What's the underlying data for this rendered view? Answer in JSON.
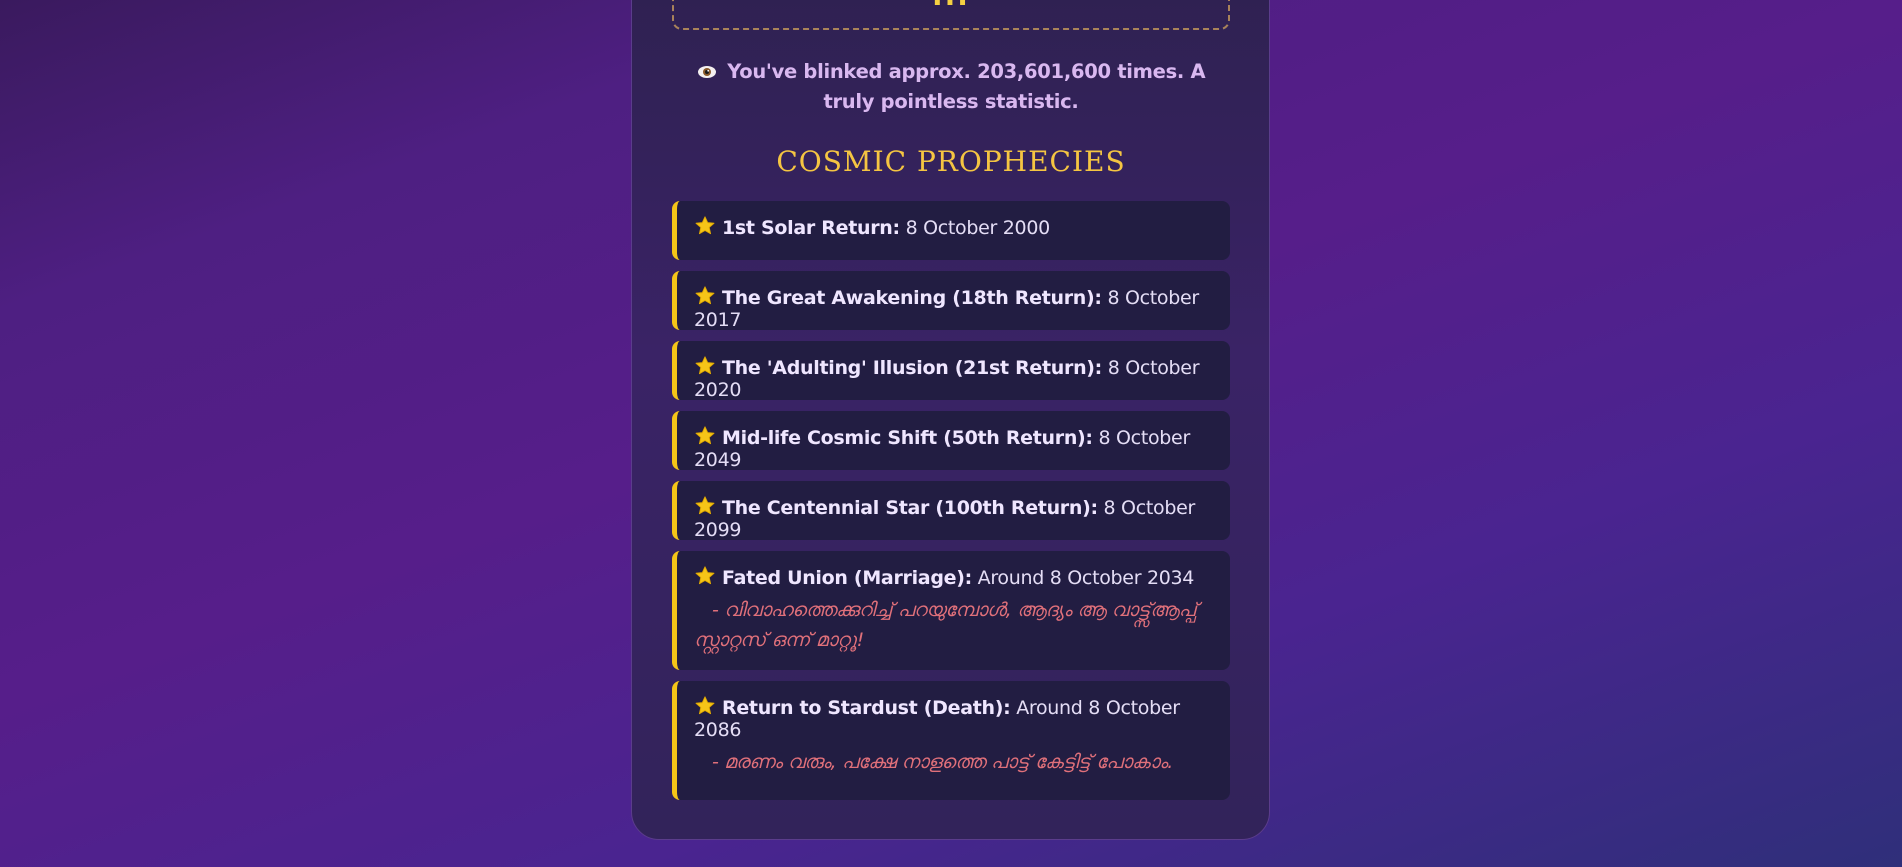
{
  "header": {
    "cut_off_text": "..."
  },
  "blink": {
    "icon": "eye-icon",
    "text": "You've blinked approx. 203,601,600 times. A truly pointless statistic."
  },
  "prophecies": {
    "title": "COSMIC PROPHECIES",
    "items": [
      {
        "icon": "star-icon",
        "label": "1st Solar Return:",
        "date": "8 October 2000",
        "note": ""
      },
      {
        "icon": "star-icon",
        "label": "The Great Awakening (18th Return):",
        "date": "8 October 2017",
        "note": ""
      },
      {
        "icon": "star-icon",
        "label": "The 'Adulting' Illusion (21st Return):",
        "date": "8 October 2020",
        "note": ""
      },
      {
        "icon": "star-icon",
        "label": "Mid-life Cosmic Shift (50th Return):",
        "date": "8 October 2049",
        "note": ""
      },
      {
        "icon": "star-icon",
        "label": "The Centennial Star (100th Return):",
        "date": "8 October 2099",
        "note": ""
      },
      {
        "icon": "star-icon",
        "label": "Fated Union (Marriage):",
        "date": "Around 8 October 2034",
        "note": "- വിവാഹത്തെക്കുറിച്ച് പറയുമ്പോൾ, ആദ്യം ആ വാട്ട്സ്ആപ്പ് സ്റ്റാറ്റസ് ഒന്ന് മാറ്റൂ!"
      },
      {
        "icon": "star-icon",
        "label": "Return to Stardust (Death):",
        "date": "Around 8 October 2086",
        "note": "- മരണം വരും, പക്ഷേ നാളത്തെ പാട്ട് കേട്ടിട്ട് പോകാം."
      }
    ]
  },
  "colors": {
    "accent_gold": "#f5c518",
    "note_red": "#e0707a",
    "card_bg": "#32235a"
  }
}
